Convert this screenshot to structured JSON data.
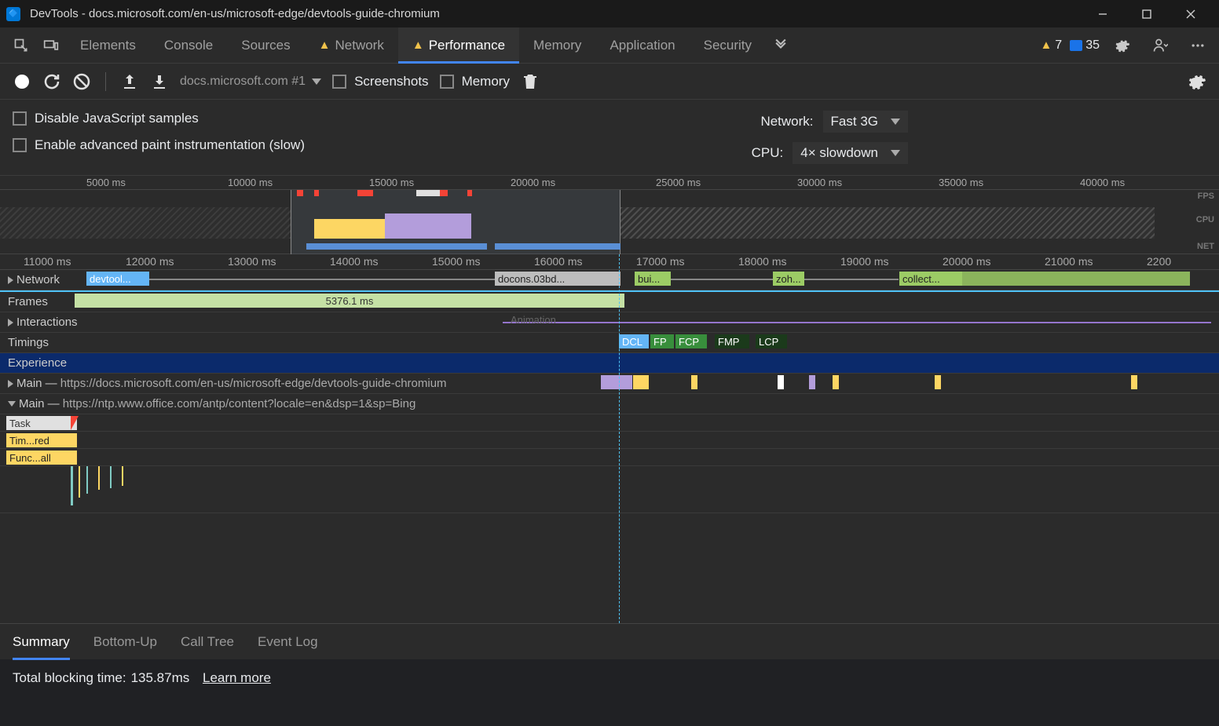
{
  "window": {
    "title": "DevTools - docs.microsoft.com/en-us/microsoft-edge/devtools-guide-chromium"
  },
  "tabs": {
    "elements": "Elements",
    "console": "Console",
    "sources": "Sources",
    "network": "Network",
    "performance": "Performance",
    "memory": "Memory",
    "application": "Application",
    "security": "Security"
  },
  "tabs_right": {
    "warning_count": "7",
    "info_count": "35"
  },
  "toolbar": {
    "recording_dropdown": "docs.microsoft.com #1",
    "screenshots_label": "Screenshots",
    "memory_label": "Memory"
  },
  "settings": {
    "disable_js": "Disable JavaScript samples",
    "enable_paint": "Enable advanced paint instrumentation (slow)",
    "network_label": "Network:",
    "network_value": "Fast 3G",
    "cpu_label": "CPU:",
    "cpu_value": "4× slowdown"
  },
  "overview": {
    "ticks": [
      "5000 ms",
      "10000 ms",
      "15000 ms",
      "20000 ms",
      "25000 ms",
      "30000 ms",
      "35000 ms",
      "40000 ms"
    ],
    "labels": {
      "fps": "FPS",
      "cpu": "CPU",
      "net": "NET"
    }
  },
  "flame": {
    "ruler": [
      "11000 ms",
      "12000 ms",
      "13000 ms",
      "14000 ms",
      "15000 ms",
      "16000 ms",
      "17000 ms",
      "18000 ms",
      "19000 ms",
      "20000 ms",
      "21000 ms",
      "2200"
    ],
    "network_label": "Network",
    "network_items": {
      "devtool": "devtool...",
      "docons": "docons.03bd...",
      "bui": "bui...",
      "zoh": "zoh...",
      "collect": "collect..."
    },
    "frames_label": "Frames",
    "frames_value": "5376.1 ms",
    "interactions_label": "Interactions",
    "interactions_note": "Animation",
    "timings_label": "Timings",
    "timings": {
      "dcl": "DCL",
      "fp": "FP",
      "fcp": "FCP",
      "fmp": "FMP",
      "lcp": "LCP"
    },
    "experience_label": "Experience",
    "main1_prefix": "Main — ",
    "main1_url": "https://docs.microsoft.com/en-us/microsoft-edge/devtools-guide-chromium",
    "main2_prefix": "Main — ",
    "main2_url": "https://ntp.www.office.com/antp/content?locale=en&dsp=1&sp=Bing",
    "task_label": "Task",
    "timer_label": "Tim...red",
    "func_label": "Func...all"
  },
  "bottom_tabs": {
    "summary": "Summary",
    "bottom_up": "Bottom-Up",
    "call_tree": "Call Tree",
    "event_log": "Event Log"
  },
  "summary": {
    "blocking_prefix": "Total blocking time: ",
    "blocking_value": "135.87ms",
    "learn_more": "Learn more"
  }
}
